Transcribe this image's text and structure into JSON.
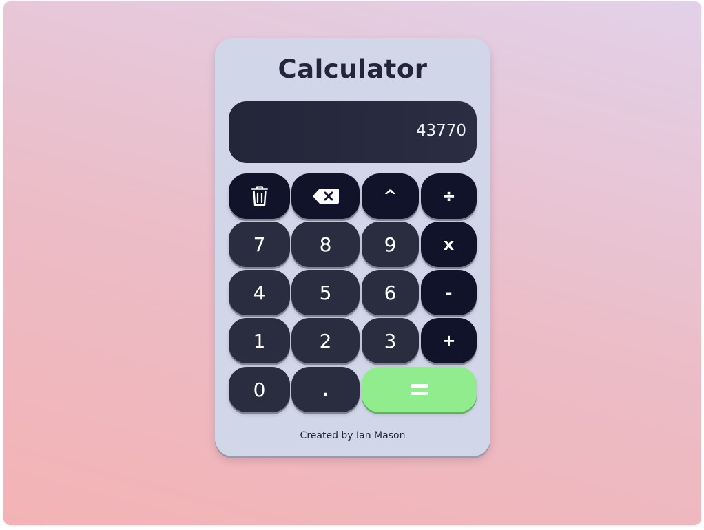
{
  "app": {
    "title": "Calculator",
    "footer": "Created by Ian Mason"
  },
  "display": {
    "value": "43770"
  },
  "keys": {
    "clear": {
      "icon": "trash-icon"
    },
    "backspace": {
      "icon": "backspace-icon"
    },
    "power": "^",
    "divide": "÷",
    "seven": "7",
    "eight": "8",
    "nine": "9",
    "multiply": "x",
    "four": "4",
    "five": "5",
    "six": "6",
    "subtract": "-",
    "one": "1",
    "two": "2",
    "three": "3",
    "add": "+",
    "zero": "0",
    "decimal": ".",
    "equals": {
      "icon": "equals-icon"
    }
  },
  "colors": {
    "operator_key": "#11132a",
    "number_key": "#2a2c40",
    "equals_key": "#90ec8c",
    "panel": "#d1d7e8",
    "display": "#232539"
  }
}
